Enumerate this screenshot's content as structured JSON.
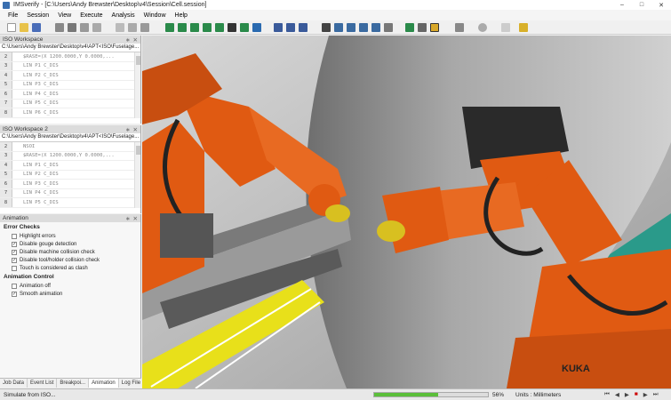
{
  "window": {
    "title": "IMSverify - [C:\\Users\\Andy Brewster\\Desktop\\v4\\Session\\Cell.session]"
  },
  "menu": [
    "File",
    "Session",
    "View",
    "Execute",
    "Analysis",
    "Window",
    "Help"
  ],
  "workspace1": {
    "title": "ISO Workspace",
    "path": "C:\\Users\\Andy Brewster\\Desktop\\v4\\APT<ISO\\Fuselage...",
    "lines": [
      {
        "n": "2",
        "code": "$RASE=(X 1200.0000,Y 0.0000,..."
      },
      {
        "n": "3",
        "code": "LIN P1 C_DIS"
      },
      {
        "n": "4",
        "code": "LIN P2 C_DIS"
      },
      {
        "n": "5",
        "code": "LIN P3 C_DIS"
      },
      {
        "n": "6",
        "code": "LIN P4 C_DIS"
      },
      {
        "n": "7",
        "code": "LIN P5 C_DIS"
      },
      {
        "n": "8",
        "code": "LIN P6 C_DIS"
      }
    ]
  },
  "workspace2": {
    "title": "ISO Workspace 2",
    "path": "C:\\Users\\Andy Brewster\\Desktop\\v4\\APT<ISO\\Fuselage...",
    "lines": [
      {
        "n": "2",
        "code": "NSOI"
      },
      {
        "n": "3",
        "code": "$RASE=(X 1200.0000,Y 0.0000,..."
      },
      {
        "n": "4",
        "code": "LIN P1 C_DIS"
      },
      {
        "n": "5",
        "code": "LIN P2 C_DIS"
      },
      {
        "n": "6",
        "code": "LIN P3 C_DIS"
      },
      {
        "n": "7",
        "code": "LIN P4 C_DIS"
      },
      {
        "n": "8",
        "code": "LIN P5 C_DIS"
      }
    ]
  },
  "animation": {
    "title": "Animation",
    "error_checks_title": "Error Checks",
    "error_checks": [
      {
        "label": "Highlight errors",
        "checked": false
      },
      {
        "label": "Disable gouge detection",
        "checked": true
      },
      {
        "label": "Disable machine collision check",
        "checked": true
      },
      {
        "label": "Disable tool/holder collision check",
        "checked": true
      },
      {
        "label": "Touch is considered as clash",
        "checked": false
      }
    ],
    "control_title": "Animation Control",
    "controls": [
      {
        "label": "Animation off",
        "checked": false
      },
      {
        "label": "Smooth animation",
        "checked": true
      }
    ]
  },
  "bottom_tabs": [
    "Job Data",
    "Event List",
    "Breakpoi...",
    "Animation",
    "Log File"
  ],
  "active_tab": "Animation",
  "status": {
    "left": "Simulate from ISO...",
    "progress_label": "56%",
    "progress": 0.56,
    "units": "Units : Millimeters"
  },
  "viewport": {
    "logo_text": "KUKA"
  },
  "colors": {
    "robot_orange": "#e05a12",
    "floor_teal": "#2a9a8a",
    "cell_grey": "#8c8c8c"
  }
}
